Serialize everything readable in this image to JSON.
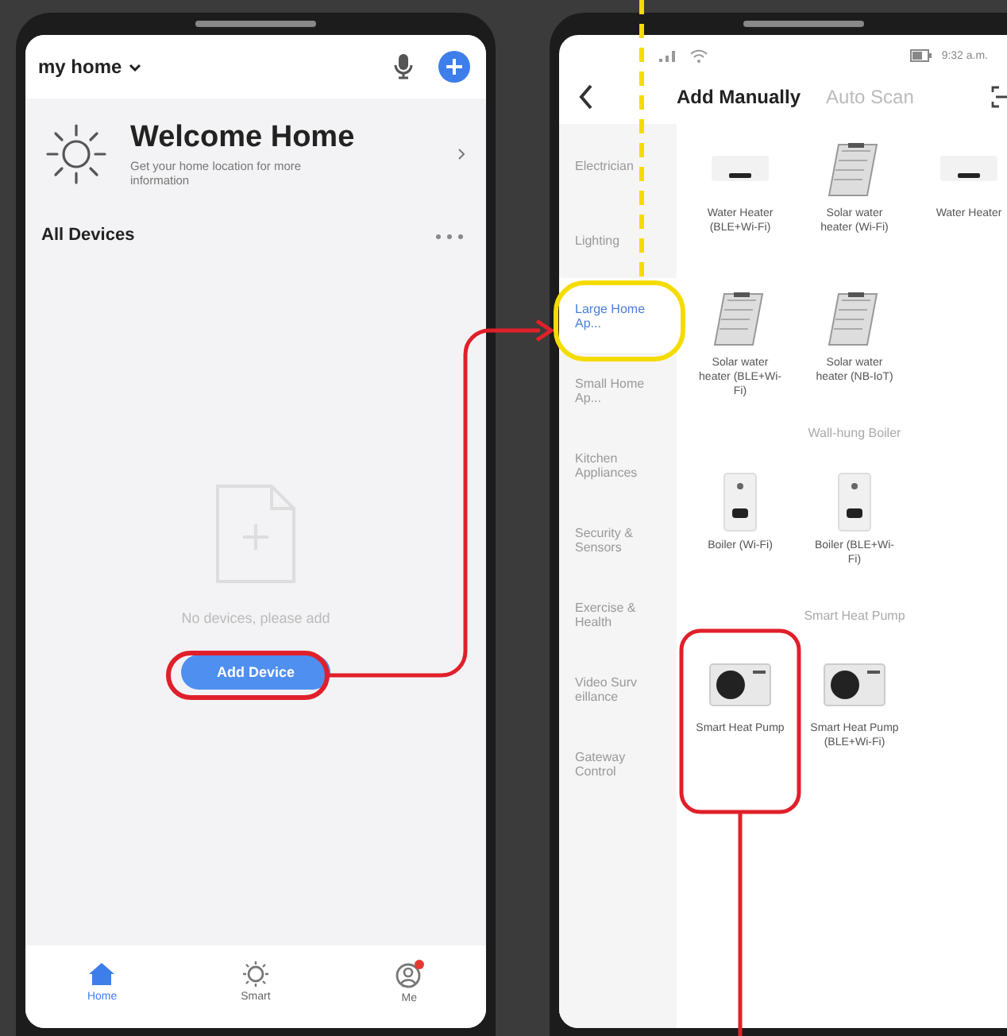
{
  "home_screen": {
    "home_name": "my home",
    "welcome_title": "Welcome Home",
    "welcome_subtitle": "Get your home location for more information",
    "section_title": "All Devices",
    "empty_message": "No devices, please add",
    "add_button": "Add Device",
    "tabs": [
      {
        "label": "Home",
        "selected": true,
        "kind": "home"
      },
      {
        "label": "Smart",
        "selected": false,
        "kind": "smart"
      },
      {
        "label": "Me",
        "selected": false,
        "kind": "me"
      }
    ]
  },
  "add_screen": {
    "status_time": "9:32 a.m.",
    "tabs": [
      {
        "label": "Add Manually",
        "selected": true
      },
      {
        "label": "Auto Scan",
        "selected": false
      }
    ],
    "categories": [
      {
        "label": "Electrician",
        "selected": false
      },
      {
        "label": "Lighting",
        "selected": false
      },
      {
        "label": "Large Home Ap...",
        "selected": true
      },
      {
        "label": "Small Home Ap...",
        "selected": false
      },
      {
        "label": "Kitchen Appliances",
        "selected": false
      },
      {
        "label": "Security & Sensors",
        "selected": false
      },
      {
        "label": "Exercise & Health",
        "selected": false
      },
      {
        "label": "Video Surv eillance",
        "selected": false
      },
      {
        "label": "Gateway Control",
        "selected": false
      }
    ],
    "sections": [
      {
        "items": [
          {
            "label": "Water Heater (BLE+Wi-Fi)",
            "kind": "water-heater"
          },
          {
            "label": "Solar water heater (Wi-Fi)",
            "kind": "solar-heater"
          },
          {
            "label": "Water Heater",
            "kind": "water-heater"
          },
          {
            "label": "Solar water heater (BLE+Wi-Fi)",
            "kind": "solar-heater"
          },
          {
            "label": "Solar water heater (NB-IoT)",
            "kind": "solar-heater"
          }
        ]
      },
      {
        "title": "Wall-hung Boiler",
        "items": [
          {
            "label": "Boiler (Wi-Fi)",
            "kind": "boiler"
          },
          {
            "label": "Boiler (BLE+Wi-Fi)",
            "kind": "boiler"
          }
        ]
      },
      {
        "title": "Smart Heat Pump",
        "items": [
          {
            "label": "Smart Heat Pump",
            "kind": "heat-pump"
          },
          {
            "label": "Smart Heat Pump (BLE+Wi-Fi)",
            "kind": "heat-pump"
          }
        ]
      }
    ]
  }
}
